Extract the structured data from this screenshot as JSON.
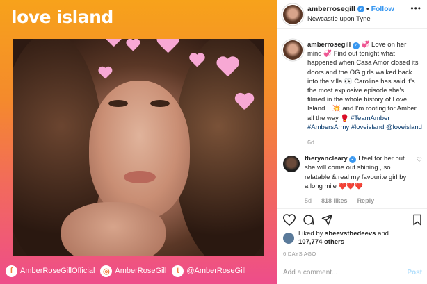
{
  "media": {
    "logo_text": "love island",
    "footer_handles": [
      {
        "icon": "facebook-icon",
        "text": "AmberRoseGillOfficial"
      },
      {
        "icon": "instagram-icon",
        "text": "AmberRoseGill"
      },
      {
        "icon": "twitter-icon",
        "text": "@AmberRoseGill"
      }
    ]
  },
  "header": {
    "username": "amberrosegill",
    "separator": "•",
    "follow_label": "Follow",
    "location": "Newcastle upon Tyne",
    "more_label": "•••"
  },
  "caption": {
    "username": "amberrosegill",
    "text_1": "💞 Love on her mind 💞 Find out tonight what happened when Casa Amor closed its doors and the OG girls walked back into the villa 👀 Caroline has said it's the most explosive episode she's filmed in the whole history of Love Island... 💥 and I'm rooting for Amber all the way 🥊",
    "hashtags": "#TeamAmber #AmbersArmy #loveisland @loveisland",
    "age": "6d"
  },
  "comment": {
    "username": "theryancleary",
    "text": "I feel for her but she will come out shining , so relatable & real my favourite girl by a long mile ❤️❤️❤️",
    "age": "5d",
    "likes": "818 likes",
    "reply_label": "Reply"
  },
  "likes": {
    "prefix": "Liked by",
    "liker": "sheevsthedeevs",
    "conjunction": "and",
    "others": "107,774 others"
  },
  "timestamp": "6 DAYS AGO",
  "add_comment": {
    "placeholder": "Add a comment...",
    "post_label": "Post"
  },
  "colors": {
    "accent": "#3897f0",
    "gradient_top": "#f7a21b",
    "gradient_bottom": "#ee4d8a",
    "heart_filter": "#f7a8d4"
  }
}
